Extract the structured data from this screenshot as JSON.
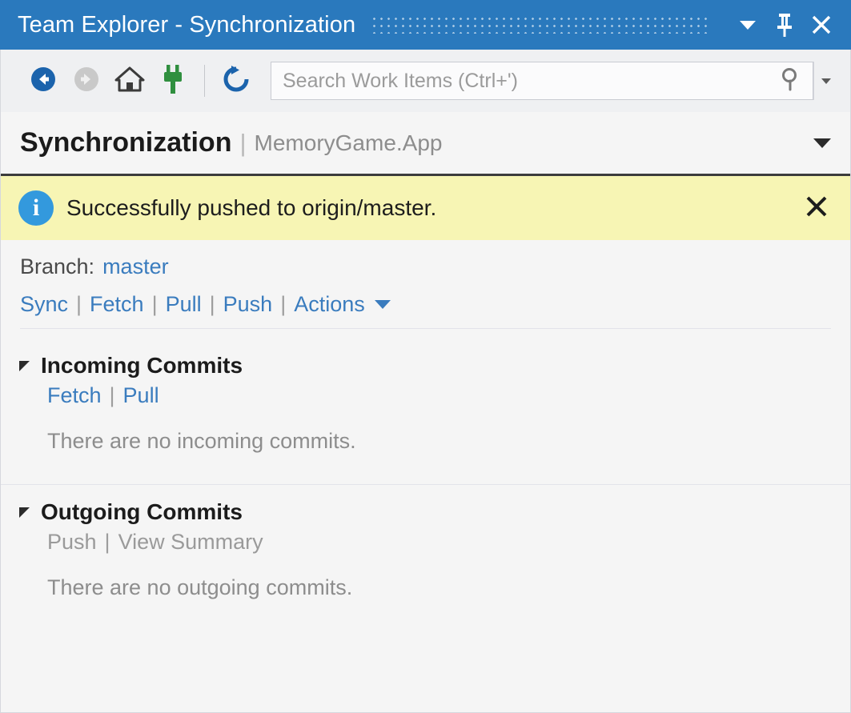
{
  "titlebar": {
    "title": "Team Explorer - Synchronization",
    "dropdown_icon": "chevron-down-icon",
    "pin_icon": "pin-icon",
    "close_icon": "close-icon"
  },
  "toolbar": {
    "back_icon": "back-arrow-icon",
    "forward_icon": "forward-arrow-icon",
    "home_icon": "home-icon",
    "connect_icon": "plug-connect-icon",
    "refresh_icon": "refresh-icon",
    "search_placeholder": "Search Work Items (Ctrl+')",
    "search_value": "",
    "search_icon": "search-magnifier-icon",
    "search_dropdown_icon": "chevron-down-icon"
  },
  "page": {
    "title": "Synchronization",
    "separator": "|",
    "subtitle": "MemoryGame.App",
    "menu_icon": "chevron-down-icon"
  },
  "notification": {
    "icon": "info-icon",
    "icon_glyph": "i",
    "message": "Successfully pushed to origin/master.",
    "close_icon": "close-icon",
    "background": "#f7f5b4"
  },
  "branch": {
    "label": "Branch:",
    "name": "master"
  },
  "branch_actions": {
    "sync": "Sync",
    "fetch": "Fetch",
    "pull": "Pull",
    "push": "Push",
    "actions": "Actions",
    "separator": "|"
  },
  "sections": [
    {
      "title": "Incoming Commits",
      "expander_icon": "triangle-expanded-icon",
      "links": [
        {
          "label": "Fetch",
          "disabled": false
        },
        {
          "label": "Pull",
          "disabled": false
        }
      ],
      "separator": "|",
      "status": "There are no incoming commits."
    },
    {
      "title": "Outgoing Commits",
      "expander_icon": "triangle-expanded-icon",
      "links": [
        {
          "label": "Push",
          "disabled": true
        },
        {
          "label": "View Summary",
          "disabled": true
        }
      ],
      "separator": "|",
      "status": "There are no outgoing commits."
    }
  ],
  "colors": {
    "titlebar_blue": "#2a79bd",
    "link_blue": "#3a7cbe",
    "notification_yellow": "#f7f5b4",
    "disabled_gray": "#9a9a9a",
    "background": "#f5f5f5"
  }
}
